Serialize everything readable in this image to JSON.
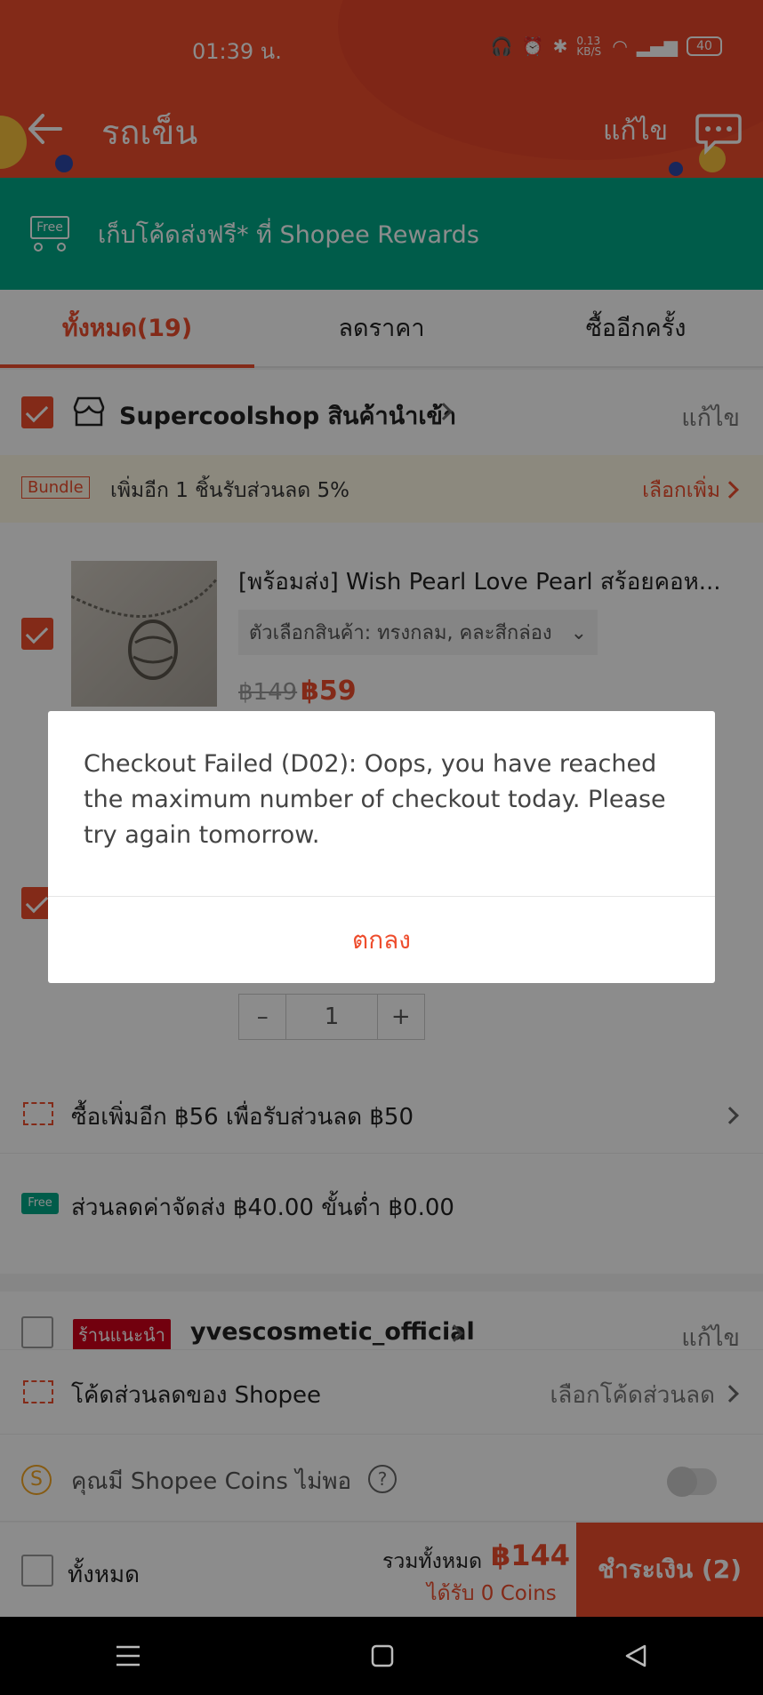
{
  "status_bar": {
    "time": "01:39 น.",
    "network_speed": "0.13 KB/S",
    "battery": "40"
  },
  "header": {
    "title": "รถเข็น",
    "edit_label": "แก้ไข"
  },
  "rewards_banner": {
    "badge": "Free",
    "text": "เก็บโค้ดส่งฟรี* ที่ Shopee Rewards"
  },
  "tabs": [
    {
      "label": "ทั้งหมด(19)",
      "active": true
    },
    {
      "label": "ลดราคา",
      "active": false
    },
    {
      "label": "ซื้ออีกครั้ง",
      "active": false
    }
  ],
  "shop1": {
    "name": "Supercoolshop สินค้านำเข้า",
    "edit_label": "แก้ไข"
  },
  "bundle": {
    "tag": "Bundle",
    "text": "เพิ่มอีก 1 ชิ้นรับส่วนลด 5%",
    "more_label": "เลือกเพิ่ม"
  },
  "product1": {
    "title": "[พร้อมส่ง] Wish Pearl Love Pearl สร้อยคอห...",
    "variant": "ตัวเลือกสินค้า: ทรงกลม, คละสีกล่อง",
    "price_old": "฿149",
    "price_new": "฿59"
  },
  "stepper": {
    "minus": "–",
    "quantity": "1",
    "plus": "+"
  },
  "buy_more": {
    "text": "ซื้อเพิ่มอีก ฿56 เพื่อรับส่วนลด ฿50"
  },
  "shipping": {
    "badge": "Free",
    "text": "ส่วนลดค่าจัดส่ง ฿40.00 ขั้นต่ำ ฿0.00"
  },
  "shop2": {
    "tag": "ร้านแนะนำ",
    "name": "yvescosmetic_official",
    "edit_label": "แก้ไข"
  },
  "voucher": {
    "label": "โค้ดส่วนลดของ Shopee",
    "action": "เลือกโค้ดส่วนลด"
  },
  "coins": {
    "symbol": "S",
    "label": "คุณมี Shopee Coins ไม่พอ",
    "help": "?"
  },
  "bottom_bar": {
    "select_all": "ทั้งหมด",
    "total_label": "รวมทั้งหมด",
    "total_amount": "฿144",
    "earn_coins": "ได้รับ 0  Coins",
    "checkout_label": "ชำระเงิน (2)"
  },
  "dialog": {
    "message": "Checkout Failed (D02): Oops, you have reached the maximum number of checkout today. Please try again tomorrow.",
    "ok_label": "ตกลง"
  },
  "colors": {
    "brand": "#ee4d2d",
    "teal": "#00a888"
  }
}
